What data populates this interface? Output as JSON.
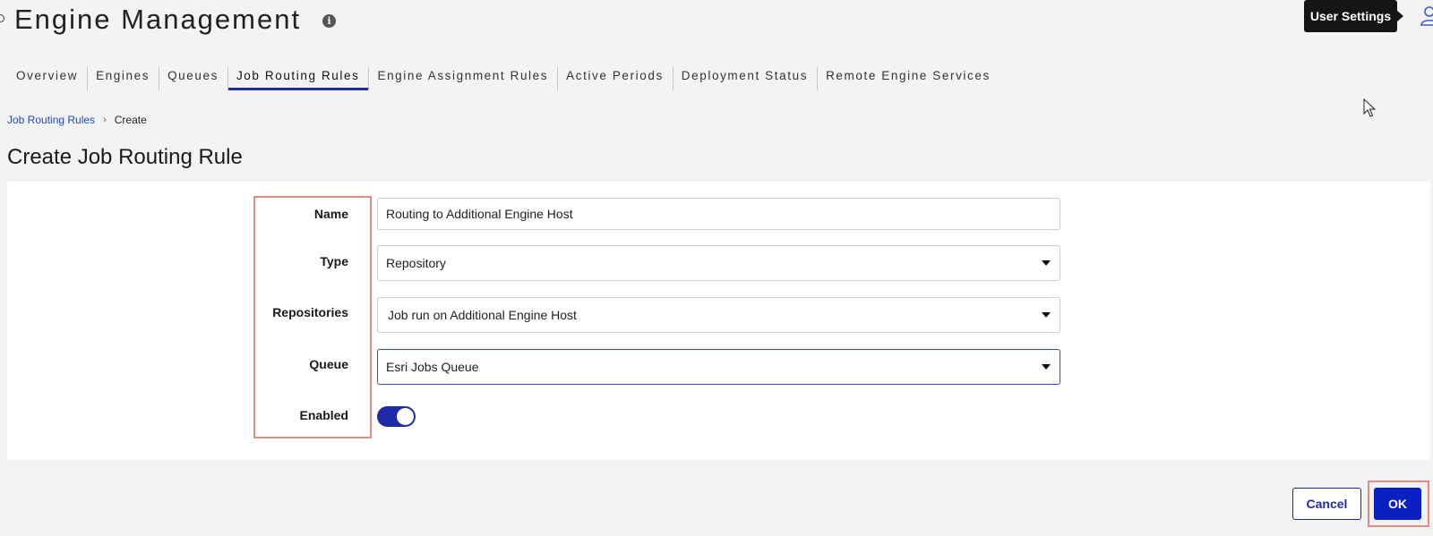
{
  "header": {
    "title": "Engine Management",
    "info_icon": "info-icon",
    "tooltip": "User Settings",
    "user_icon": "user-icon"
  },
  "tabs": [
    {
      "label": "Overview",
      "active": false
    },
    {
      "label": "Engines",
      "active": false
    },
    {
      "label": "Queues",
      "active": false
    },
    {
      "label": "Job Routing Rules",
      "active": true
    },
    {
      "label": "Engine Assignment Rules",
      "active": false
    },
    {
      "label": "Active Periods",
      "active": false
    },
    {
      "label": "Deployment Status",
      "active": false
    },
    {
      "label": "Remote Engine Services",
      "active": false
    }
  ],
  "breadcrumb": {
    "parent": "Job Routing Rules",
    "separator_icon": "chevron-right-icon",
    "current": "Create"
  },
  "form": {
    "title": "Create Job Routing Rule",
    "name": {
      "label": "Name",
      "value": "Routing to Additional Engine Host"
    },
    "type": {
      "label": "Type",
      "value": "Repository"
    },
    "repositories": {
      "label": "Repositories",
      "value": "Job run on Additional Engine Host"
    },
    "queue": {
      "label": "Queue",
      "value": "Esri Jobs Queue"
    },
    "enabled": {
      "label": "Enabled",
      "value": true
    }
  },
  "actions": {
    "cancel": "Cancel",
    "ok": "OK"
  },
  "colors": {
    "accent": "#1e2aa6",
    "primary_button": "#0b1fc2",
    "highlight_outline": "#e88a84",
    "focus": "#2b4fd6"
  }
}
